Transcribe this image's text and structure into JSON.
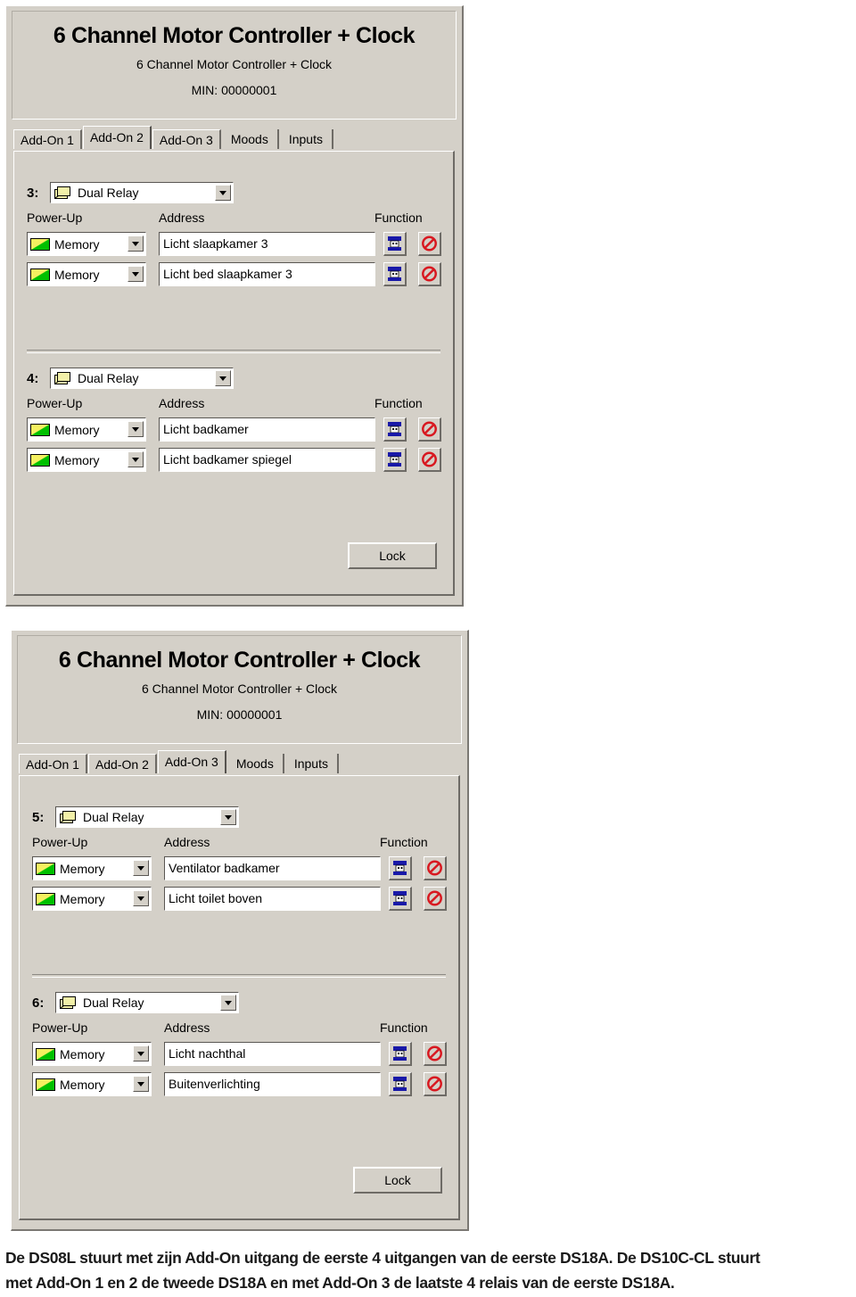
{
  "panels": [
    {
      "header": {
        "title": "6 Channel Motor Controller + Clock",
        "subtitle": "6 Channel Motor Controller + Clock",
        "min": "MIN: 00000001"
      },
      "tabs": [
        {
          "label": "Add-On 1",
          "active": false
        },
        {
          "label": "Add-On 2",
          "active": true
        },
        {
          "label": "Add-On 3",
          "active": false
        },
        {
          "label": "Moods",
          "active": false
        },
        {
          "label": "Inputs",
          "active": false
        }
      ],
      "columns": {
        "power_up": "Power-Up",
        "address": "Address",
        "function": "Function"
      },
      "groups": [
        {
          "channel": "3:",
          "type": "Dual Relay",
          "type_icon": "dual-relay-icon",
          "rows": [
            {
              "power_up": "Memory",
              "power_up_icon": "memory-icon",
              "address": "Licht slaapkamer 3",
              "fn1_icon": "user-profile-icon",
              "fn2_icon": "no-entry-icon"
            },
            {
              "power_up": "Memory",
              "power_up_icon": "memory-icon",
              "address": "Licht bed slaapkamer 3",
              "fn1_icon": "user-profile-icon",
              "fn2_icon": "no-entry-icon"
            }
          ]
        },
        {
          "channel": "4:",
          "type": "Dual Relay",
          "type_icon": "dual-relay-icon",
          "rows": [
            {
              "power_up": "Memory",
              "power_up_icon": "memory-icon",
              "address": "Licht badkamer",
              "fn1_icon": "user-profile-icon",
              "fn2_icon": "no-entry-icon"
            },
            {
              "power_up": "Memory",
              "power_up_icon": "memory-icon",
              "address": "Licht badkamer spiegel",
              "fn1_icon": "user-profile-icon",
              "fn2_icon": "no-entry-icon"
            }
          ]
        }
      ],
      "lock_label": "Lock"
    },
    {
      "header": {
        "title": "6 Channel Motor Controller + Clock",
        "subtitle": "6 Channel Motor Controller + Clock",
        "min": "MIN: 00000001"
      },
      "tabs": [
        {
          "label": "Add-On 1",
          "active": false
        },
        {
          "label": "Add-On 2",
          "active": false
        },
        {
          "label": "Add-On 3",
          "active": true
        },
        {
          "label": "Moods",
          "active": false
        },
        {
          "label": "Inputs",
          "active": false
        }
      ],
      "columns": {
        "power_up": "Power-Up",
        "address": "Address",
        "function": "Function"
      },
      "groups": [
        {
          "channel": "5:",
          "type": "Dual Relay",
          "type_icon": "dual-relay-icon",
          "rows": [
            {
              "power_up": "Memory",
              "power_up_icon": "memory-icon",
              "address": "Ventilator badkamer",
              "fn1_icon": "user-profile-icon",
              "fn2_icon": "no-entry-icon"
            },
            {
              "power_up": "Memory",
              "power_up_icon": "memory-icon",
              "address": "Licht toilet boven",
              "fn1_icon": "user-profile-icon",
              "fn2_icon": "no-entry-icon"
            }
          ]
        },
        {
          "channel": "6:",
          "type": "Dual Relay",
          "type_icon": "dual-relay-icon",
          "rows": [
            {
              "power_up": "Memory",
              "power_up_icon": "memory-icon",
              "address": "Licht nachthal",
              "fn1_icon": "user-profile-icon",
              "fn2_icon": "no-entry-icon"
            },
            {
              "power_up": "Memory",
              "power_up_icon": "memory-icon",
              "address": "Buitenverlichting",
              "fn1_icon": "user-profile-icon",
              "fn2_icon": "no-entry-icon"
            }
          ]
        }
      ],
      "lock_label": "Lock"
    }
  ],
  "caption": {
    "line1": "De DS08L stuurt met zijn Add-On uitgang de eerste 4 uitgangen van de eerste DS18A. De DS10C-CL stuurt",
    "line2": "met Add-On 1 en 2 de tweede DS18A en met Add-On 3 de laatste 4 relais van de eerste DS18A."
  },
  "colors": {
    "window_face": "#d4d0c8",
    "relay_yellow": "#f2f0a8",
    "memory_yellow": "#f5f060",
    "memory_green": "#00c000",
    "no_entry_red": "#d81820",
    "profile_blue": "#1818a8"
  }
}
